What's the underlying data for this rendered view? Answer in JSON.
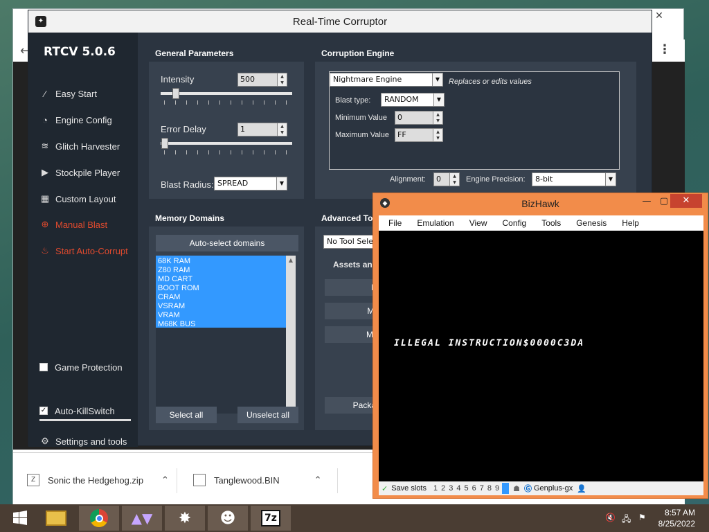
{
  "chrome": {
    "back_icon": "back-arrow-icon",
    "menu_icon": "more-vert-icon",
    "downloads": [
      {
        "name": "Sonic the Hedgehog.zip",
        "icon": "zip-file-icon"
      },
      {
        "name": "Tanglewood.BIN",
        "icon": "file-icon"
      }
    ]
  },
  "rtcv": {
    "window_title": "Real-Time Corruptor",
    "version": "RTCV 5.0.6",
    "nav": [
      {
        "label": "Easy Start",
        "icon": "magic-wand-icon"
      },
      {
        "label": "Engine Config",
        "icon": "gauge-icon"
      },
      {
        "label": "Glitch Harvester",
        "icon": "layers-icon"
      },
      {
        "label": "Stockpile Player",
        "icon": "play-icon"
      },
      {
        "label": "Custom Layout",
        "icon": "grid-icon"
      },
      {
        "label": "Manual Blast",
        "icon": "crosshair-icon"
      },
      {
        "label": "Start Auto-Corrupt",
        "icon": "flame-icon"
      }
    ],
    "game_protection": {
      "label": "Game Protection",
      "checked": false
    },
    "auto_killswitch": {
      "label": "Auto-KillSwitch",
      "checked": true
    },
    "settings": {
      "label": "Settings and tools",
      "icon": "gear-icon"
    },
    "general": {
      "title": "General Parameters",
      "intensity_label": "Intensity",
      "intensity_value": "500",
      "error_delay_label": "Error Delay",
      "error_delay_value": "1",
      "blast_radius_label": "Blast Radius:",
      "blast_radius_value": "SPREAD"
    },
    "memory": {
      "title": "Memory Domains",
      "autoselect": "Auto-select domains",
      "domains": [
        "68K RAM",
        "Z80 RAM",
        "MD CART",
        "BOOT ROM",
        "CRAM",
        "VSRAM",
        "VRAM",
        "M68K BUS"
      ],
      "select_all": "Select all",
      "unselect_all": "Unselect all"
    },
    "engine": {
      "title": "Corruption Engine",
      "engine_value": "Nightmare Engine",
      "engine_desc": "Replaces or edits values",
      "blast_type_label": "Blast type:",
      "blast_type_value": "RANDOM",
      "min_label": "Minimum Value",
      "min_value": "0",
      "max_label": "Maximum Value",
      "max_value": "FF",
      "alignment_label": "Alignment:",
      "alignment_value": "0",
      "precision_label": "Engine Precision:",
      "precision_value": "8-bit"
    },
    "advanced": {
      "title": "Advanced Too",
      "tool_select": "No Tool Selec",
      "assets_label": "Assets and",
      "btn1": "My",
      "btn2": "My V",
      "btn3": "My Pl",
      "package": "Package D"
    }
  },
  "bizhawk": {
    "title": "BizHawk",
    "menu": [
      "File",
      "Emulation",
      "View",
      "Config",
      "Tools",
      "Genesis",
      "Help"
    ],
    "screen_text": "ILLEGAL INSTRUCTION$0000C3DA",
    "status": {
      "save_slots": "Save slots",
      "slots": [
        "1",
        "2",
        "3",
        "4",
        "5",
        "6",
        "7",
        "8",
        "9"
      ],
      "core": "Genplus-gx"
    }
  },
  "taskbar": {
    "time": "8:57 AM",
    "date": "8/25/2022",
    "apps": [
      "windows-start-icon",
      "file-explorer-icon",
      "chrome-icon",
      "rtcv-launcher-icon",
      "rtcv-icon",
      "anonymous-icon",
      "7zip-icon"
    ],
    "sevenzip_label": "7z"
  }
}
